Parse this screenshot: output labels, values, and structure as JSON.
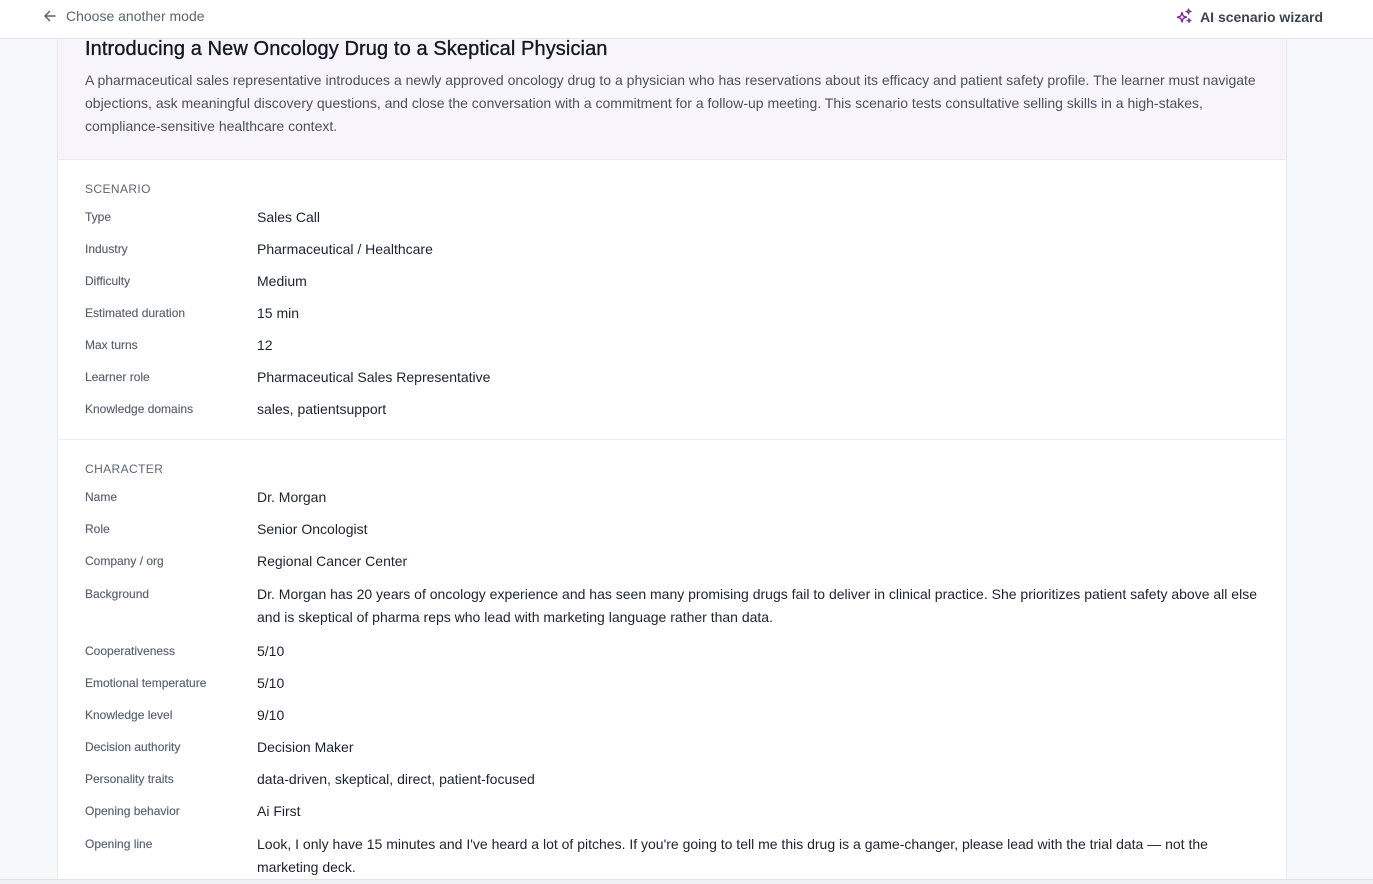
{
  "topbar": {
    "back_label": "Choose another mode",
    "wizard_label": "AI scenario wizard",
    "back_icon": "arrow-left-icon",
    "wizard_icon": "sparkles-icon",
    "accent": "#7a2e8e"
  },
  "hero": {
    "title": "Introducing a New Oncology Drug to a Skeptical Physician",
    "description": "A pharmaceutical sales representative introduces a newly approved oncology drug to a physician who has reservations about its efficacy and patient safety profile. The learner must navigate objections, ask meaningful discovery questions, and close the conversation with a commitment for a follow-up meeting. This scenario tests consultative selling skills in a high-stakes, compliance-sensitive healthcare context."
  },
  "scenario": {
    "heading": "SCENARIO",
    "rows": [
      {
        "label": "Type",
        "value": "Sales Call"
      },
      {
        "label": "Industry",
        "value": "Pharmaceutical / Healthcare"
      },
      {
        "label": "Difficulty",
        "value": "Medium"
      },
      {
        "label": "Estimated duration",
        "value": "15 min"
      },
      {
        "label": "Max turns",
        "value": "12"
      },
      {
        "label": "Learner role",
        "value": "Pharmaceutical Sales Representative"
      },
      {
        "label": "Knowledge domains",
        "value": "sales, patientsupport"
      }
    ]
  },
  "character": {
    "heading": "CHARACTER",
    "rows": [
      {
        "label": "Name",
        "value": "Dr. Morgan"
      },
      {
        "label": "Role",
        "value": "Senior Oncologist"
      },
      {
        "label": "Company / org",
        "value": "Regional Cancer Center"
      },
      {
        "label": "Background",
        "value": "Dr. Morgan has 20 years of oncology experience and has seen many promising drugs fail to deliver in clinical practice. She prioritizes patient safety above all else and is skeptical of pharma reps who lead with marketing language rather than data."
      },
      {
        "label": "Cooperativeness",
        "value": "5/10"
      },
      {
        "label": "Emotional temperature",
        "value": "5/10"
      },
      {
        "label": "Knowledge level",
        "value": "9/10"
      },
      {
        "label": "Decision authority",
        "value": "Decision Maker"
      },
      {
        "label": "Personality traits",
        "value": "data-driven, skeptical, direct, patient-focused"
      },
      {
        "label": "Opening behavior",
        "value": "Ai First"
      },
      {
        "label": "Opening line",
        "value": "Look, I only have 15 minutes and I've heard a lot of pitches. If you're going to tell me this drug is a game-changer, please lead with the trial data — not the marketing deck."
      }
    ]
  }
}
